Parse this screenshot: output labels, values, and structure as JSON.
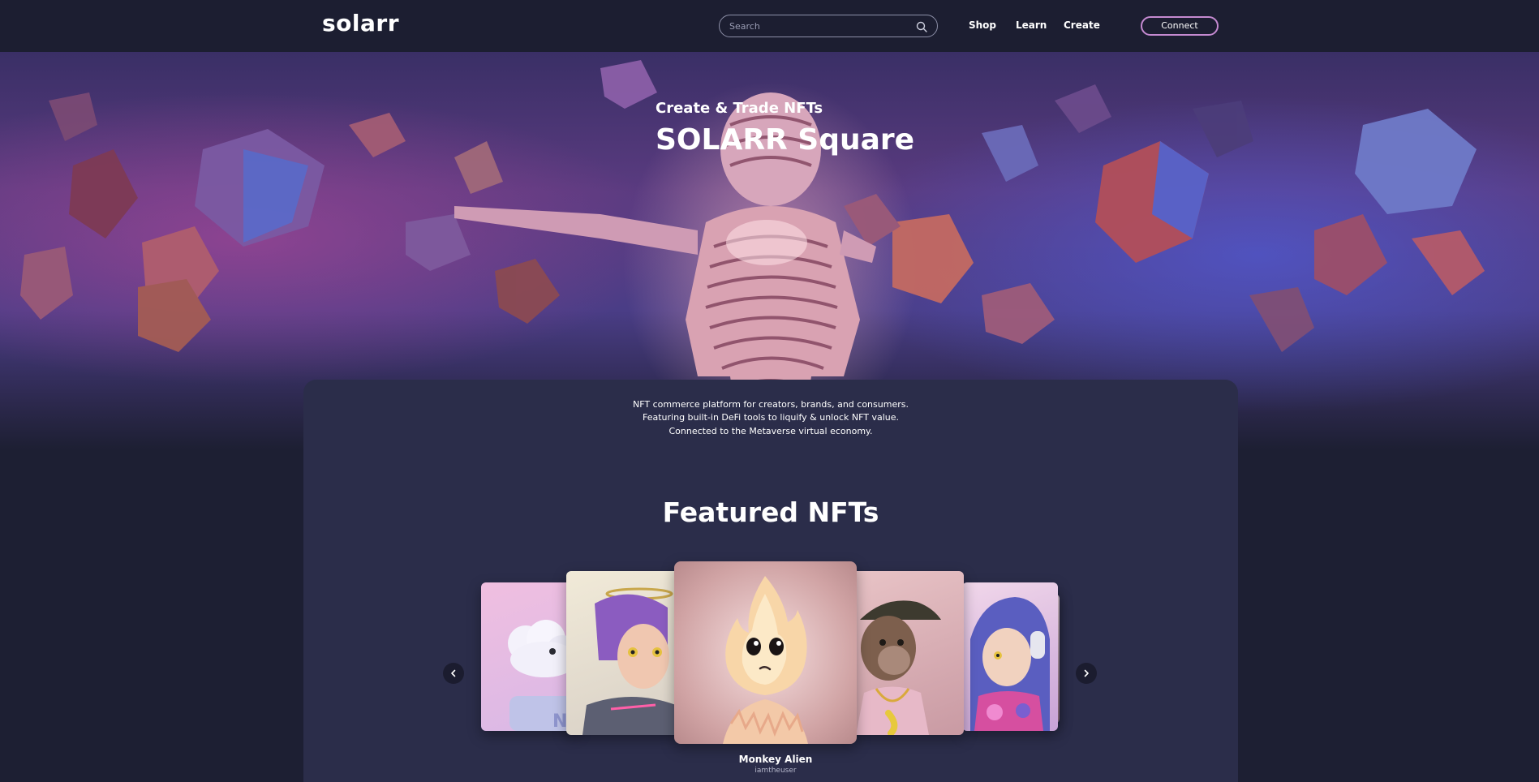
{
  "header": {
    "logo": "solarr",
    "search": {
      "placeholder": "Search",
      "value": ""
    },
    "nav": [
      "Shop",
      "Learn",
      "Create"
    ],
    "connect_label": "Connect"
  },
  "hero": {
    "kicker": "Create & Trade NFTs",
    "title": "SOLARR Square"
  },
  "intro": {
    "lines": [
      "NFT commerce platform for creators, brands, and consumers.",
      "Featuring built-in DeFi tools to liquify & unlock NFT value.",
      "Connected to the Metaverse virtual economy."
    ]
  },
  "featured": {
    "title": "Featured NFTs",
    "selected": {
      "name": "Monkey Alien",
      "creator": "iamtheuser"
    }
  },
  "icons": {
    "search": "search-icon",
    "prev": "chevron-left-icon",
    "next": "chevron-right-icon"
  },
  "colors": {
    "background": "#1d1f33",
    "panel": "#2b2d4a",
    "connect_border": "#c58ad1",
    "logo_accent": "#e84a6b"
  }
}
